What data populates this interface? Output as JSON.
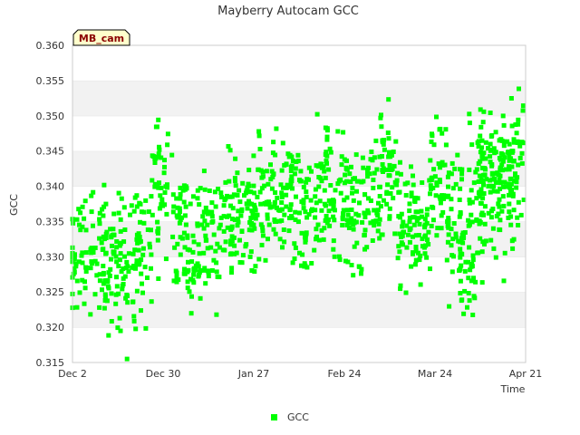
{
  "chart_data": {
    "type": "scatter",
    "title": "Mayberry Autocam GCC",
    "xlabel": "Time",
    "ylabel": "GCC",
    "site_label": "MB_cam",
    "x_ticks": [
      "Dec 2",
      "Dec 30",
      "Jan 27",
      "Feb 24",
      "Mar 24",
      "Apr 21"
    ],
    "x_range_days": [
      0,
      140
    ],
    "ylim": [
      0.315,
      0.36
    ],
    "y_ticks": [
      "0.315",
      "0.320",
      "0.325",
      "0.330",
      "0.335",
      "0.340",
      "0.345",
      "0.350",
      "0.355",
      "0.360"
    ],
    "grid": "alternating horizontal bands",
    "legend_position": "bottom-center",
    "series": [
      {
        "name": "GCC",
        "color": "#00ff00",
        "marker": "square",
        "x": [
          2,
          8,
          12,
          17,
          22,
          27,
          33,
          38,
          43,
          48,
          53,
          58,
          63,
          68,
          73,
          78,
          83,
          88,
          93,
          98,
          103,
          108,
          113,
          118,
          122,
          125,
          128,
          131,
          134,
          137
        ],
        "y": [
          0.331,
          0.33,
          0.328,
          0.328,
          0.331,
          0.339,
          0.334,
          0.329,
          0.333,
          0.336,
          0.335,
          0.338,
          0.338,
          0.339,
          0.336,
          0.34,
          0.338,
          0.336,
          0.339,
          0.341,
          0.334,
          0.333,
          0.34,
          0.335,
          0.33,
          0.338,
          0.342,
          0.341,
          0.34,
          0.343
        ]
      }
    ]
  }
}
